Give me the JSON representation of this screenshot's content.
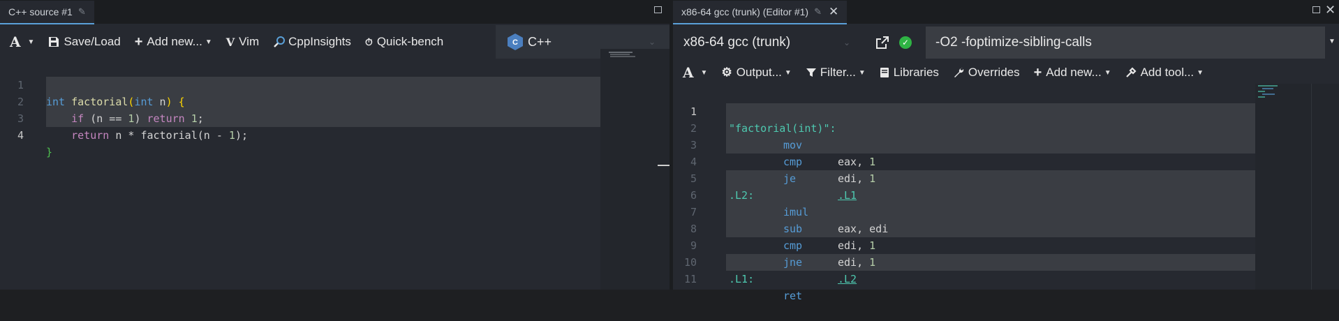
{
  "left": {
    "tab_title": "C++ source #1",
    "toolbar": {
      "save_load": "Save/Load",
      "add_new": "Add new...",
      "vim": "Vim",
      "cppinsights": "CppInsights",
      "quickbench": "Quick-bench",
      "language": "C++"
    },
    "code": {
      "line_numbers": [
        "1",
        "2",
        "3",
        "4"
      ],
      "l1": {
        "t1": "int",
        "t2": " ",
        "t3": "factorial",
        "t4": "(",
        "t5": "int",
        "t6": " n",
        "t7": ")",
        "t8": " {"
      },
      "l2": {
        "ind": "    ",
        "t1": "if",
        "t2": " (n == ",
        "t3": "1",
        "t4": ") ",
        "t5": "return",
        "t6": " ",
        "t7": "1",
        "t8": ";"
      },
      "l3": {
        "ind": "    ",
        "t1": "return",
        "t2": " n * factorial(n - ",
        "t3": "1",
        "t4": ");"
      },
      "l4": {
        "t1": "}"
      }
    }
  },
  "right": {
    "tab_title": "x86-64 gcc (trunk) (Editor #1)",
    "compiler": "x86-64 gcc (trunk)",
    "options": "-O2 -foptimize-sibling-calls",
    "toolbar": {
      "output": "Output...",
      "filter": "Filter...",
      "libraries": "Libraries",
      "overrides": "Overrides",
      "add_new": "Add new...",
      "add_tool": "Add tool..."
    },
    "asm": {
      "line_numbers": [
        "1",
        "2",
        "3",
        "4",
        "5",
        "6",
        "7",
        "8",
        "9",
        "10",
        "11"
      ],
      "l1": "\"factorial(int)\":",
      "l2": {
        "op": "mov",
        "args": "eax, ",
        "n": "1"
      },
      "l3": {
        "op": "cmp",
        "args": "edi, ",
        "n": "1"
      },
      "l4": {
        "op": "je",
        "target": ".L1"
      },
      "l5": ".L2:",
      "l6": {
        "op": "imul",
        "args": "eax, edi"
      },
      "l7": {
        "op": "sub",
        "args": "edi, ",
        "n": "1"
      },
      "l8": {
        "op": "cmp",
        "args": "edi, ",
        "n": "1"
      },
      "l9": {
        "op": "jne",
        "target": ".L2"
      },
      "l10": ".L1:",
      "l11": {
        "op": "ret"
      }
    }
  },
  "colors": {
    "background": "#262930",
    "tab_accent": "#5aa0d8",
    "highlight": "#3a3d43",
    "success": "#2fb344"
  }
}
